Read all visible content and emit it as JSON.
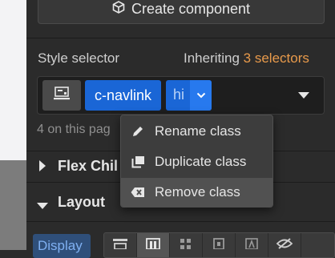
{
  "panel": {
    "create_component_label": "Create component",
    "style_selector_label": "Style selector",
    "inheriting_prefix": "Inheriting",
    "inheriting_count": "3 selectors",
    "on_page_text": "4 on this pag",
    "tags": [
      {
        "label": "c-navlink"
      },
      {
        "label": "hi"
      }
    ],
    "sections": {
      "flex_child": "Flex Chil",
      "layout": "Layout"
    },
    "display_label": "Display"
  },
  "context_menu": {
    "items": [
      {
        "label": "Rename class",
        "icon": "pencil-icon"
      },
      {
        "label": "Duplicate class",
        "icon": "duplicate-icon"
      },
      {
        "label": "Remove class",
        "icon": "backspace-icon",
        "highlighted": true
      }
    ]
  },
  "colors": {
    "tag_blue": "#1a66d6",
    "accent_orange": "#e89a4b"
  }
}
